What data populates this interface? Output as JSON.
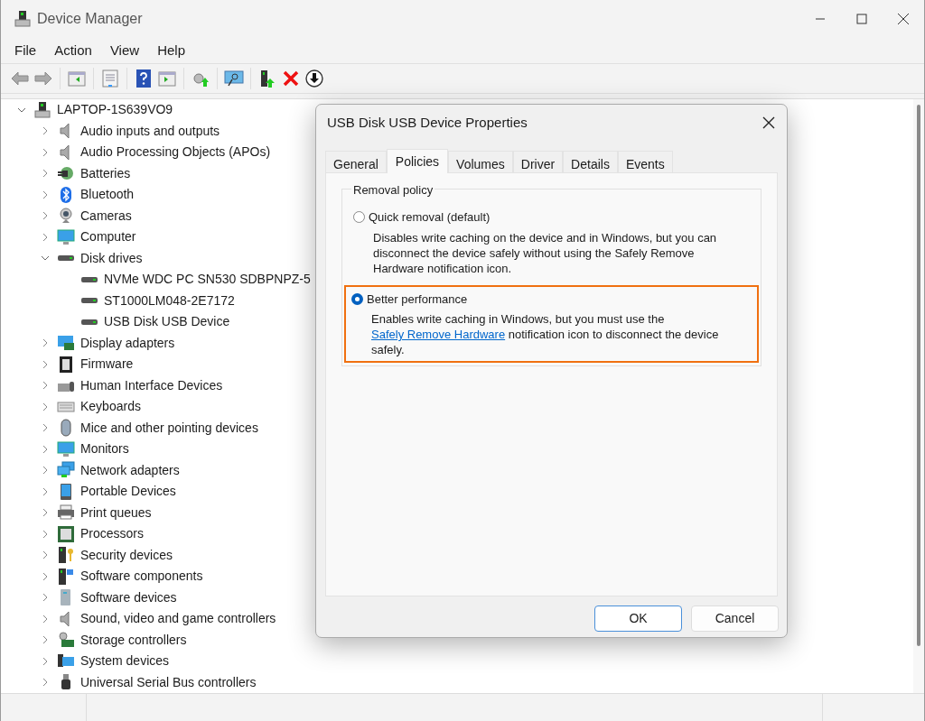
{
  "window": {
    "title": "Device Manager"
  },
  "menu": [
    "File",
    "Action",
    "View",
    "Help"
  ],
  "tree": [
    {
      "label": "LAPTOP-1S639VO9",
      "expanded": true,
      "children": [
        {
          "label": "Audio inputs and outputs",
          "expanded": false
        },
        {
          "label": "Audio Processing Objects (APOs)",
          "expanded": false
        },
        {
          "label": "Batteries",
          "expanded": false
        },
        {
          "label": "Bluetooth",
          "expanded": false
        },
        {
          "label": "Cameras",
          "expanded": false
        },
        {
          "label": "Computer",
          "expanded": false
        },
        {
          "label": "Disk drives",
          "expanded": true,
          "children": [
            {
              "label": "NVMe WDC PC SN530 SDBPNPZ-5"
            },
            {
              "label": "ST1000LM048-2E7172"
            },
            {
              "label": "USB Disk USB Device"
            }
          ]
        },
        {
          "label": "Display adapters",
          "expanded": false
        },
        {
          "label": "Firmware",
          "expanded": false
        },
        {
          "label": "Human Interface Devices",
          "expanded": false
        },
        {
          "label": "Keyboards",
          "expanded": false
        },
        {
          "label": "Mice and other pointing devices",
          "expanded": false
        },
        {
          "label": "Monitors",
          "expanded": false
        },
        {
          "label": "Network adapters",
          "expanded": false
        },
        {
          "label": "Portable Devices",
          "expanded": false
        },
        {
          "label": "Print queues",
          "expanded": false
        },
        {
          "label": "Processors",
          "expanded": false
        },
        {
          "label": "Security devices",
          "expanded": false
        },
        {
          "label": "Software components",
          "expanded": false
        },
        {
          "label": "Software devices",
          "expanded": false
        },
        {
          "label": "Sound, video and game controllers",
          "expanded": false
        },
        {
          "label": "Storage controllers",
          "expanded": false
        },
        {
          "label": "System devices",
          "expanded": false
        },
        {
          "label": "Universal Serial Bus controllers",
          "expanded": false
        }
      ]
    }
  ],
  "dialog": {
    "title": "USB Disk USB Device Properties",
    "tabs": [
      {
        "label": "General",
        "selected": false
      },
      {
        "label": "Policies",
        "selected": true
      },
      {
        "label": "Volumes",
        "selected": false
      },
      {
        "label": "Driver",
        "selected": false
      },
      {
        "label": "Details",
        "selected": false
      },
      {
        "label": "Events",
        "selected": false
      }
    ],
    "group_title": "Removal policy",
    "options": [
      {
        "label": "Quick removal (default)",
        "selected": false,
        "highlighted": false,
        "description": [
          {
            "kind": "text",
            "text": "Disables write caching on the device and in Windows, but you can disconnect the device safely without using the Safely Remove Hardware notification icon."
          }
        ]
      },
      {
        "label": "Better performance",
        "selected": true,
        "highlighted": true,
        "description": [
          {
            "kind": "text",
            "text": "Enables write caching in Windows, but you must use the "
          },
          {
            "kind": "link",
            "text": "Safely Remove Hardware"
          },
          {
            "kind": "text",
            "text": " notification icon to disconnect the device safely."
          }
        ]
      }
    ],
    "buttons": [
      {
        "label": "OK",
        "default": true
      },
      {
        "label": "Cancel",
        "default": false
      }
    ]
  }
}
